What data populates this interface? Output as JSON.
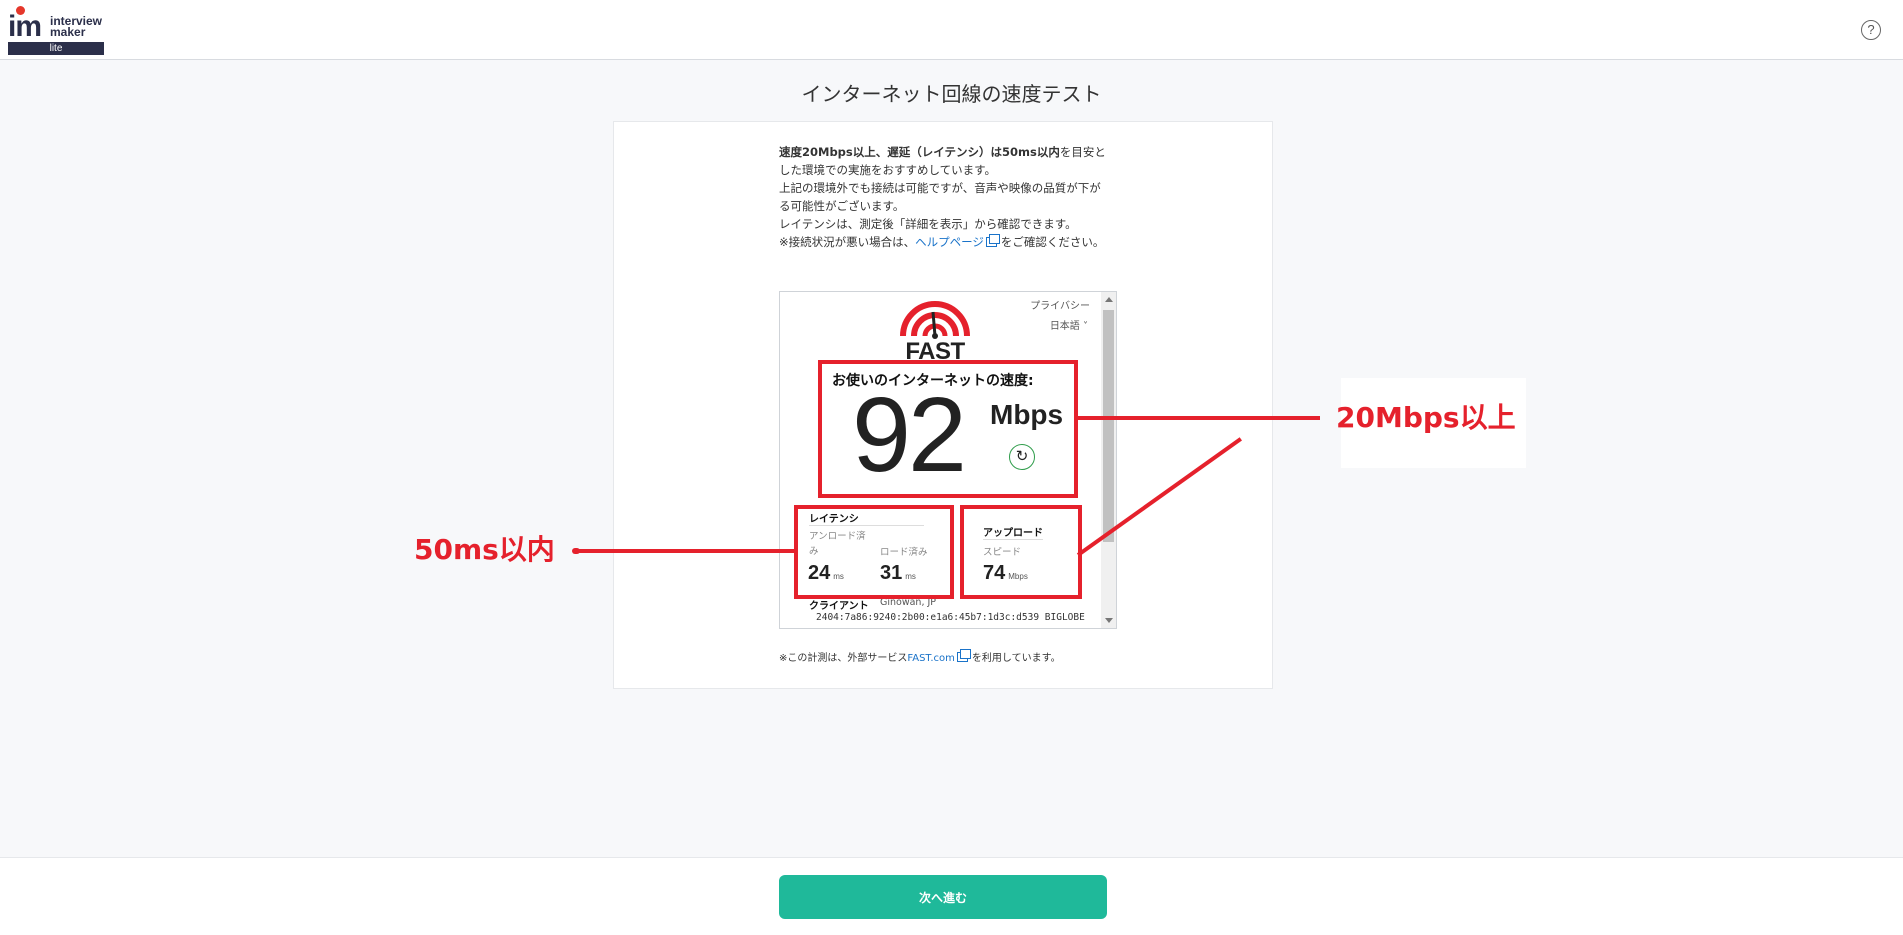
{
  "header": {
    "logo_letters": "im",
    "logo_line1": "interview",
    "logo_line2": "maker",
    "logo_sub": "lite",
    "help_icon": "?"
  },
  "page_title": "インターネット回線の速度テスト",
  "intro": {
    "bold_part": "速度20Mbps以上、遅延（レイテンシ）は50ms以内",
    "line1_rest": "を目安とした環境での実施をおすすめしています。",
    "line2": "上記の環境外でも接続は可能ですが、音声や映像の品質が下がる可能性がございます。",
    "line3": "レイテンシは、測定後「詳細を表示」から確認できます。",
    "line4_pre": "※接続状況が悪い場合は、",
    "help_link": "ヘルプページ",
    "line4_post": "をご確認ください。"
  },
  "fast": {
    "privacy": "プライバシー",
    "language": "日本語 ˅",
    "logo_word": "FAST",
    "speed_label": "お使いのインターネットの速度:",
    "speed_value": "92",
    "speed_unit": "Mbps",
    "refresh_icon": "↻",
    "latency_title": "レイテンシ",
    "latency_unloaded_label": "アンロード済み",
    "latency_loaded_label": "ロード済み",
    "latency_unloaded_value": "24",
    "latency_loaded_value": "31",
    "latency_unit": "ms",
    "upload_title": "アップロード",
    "upload_sub": "スピード",
    "upload_value": "74",
    "upload_unit": "Mbps",
    "client_label": "クライアント",
    "client_location": "Ginowan, JP",
    "client_ip": "2404:7a86:9240:2b00:e1a6:45b7:1d3c:d539   BIGLOBE"
  },
  "annotations": {
    "speed": "20Mbps以上",
    "latency": "50ms以内"
  },
  "note": {
    "pre": "※この計測は、外部サービス",
    "link": "FAST.com",
    "post": "を利用しています。"
  },
  "footer": {
    "next_button": "次へ進む"
  },
  "colors": {
    "accent": "#1fb99a",
    "annotation_red": "#e5212c",
    "link": "#1a73c9",
    "fast_red": "#e5212c"
  }
}
